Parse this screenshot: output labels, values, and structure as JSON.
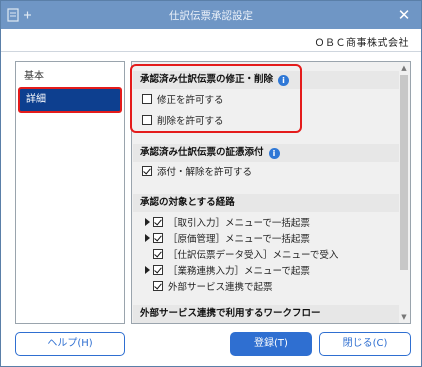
{
  "window": {
    "title": "仕訳伝票承認設定",
    "close_glyph": "✕",
    "company": "ＯＢＣ商事株式会社"
  },
  "nav": {
    "items": [
      {
        "label": "基本"
      },
      {
        "label": "詳細",
        "selected": true
      }
    ]
  },
  "content": {
    "section1": {
      "title": "承認済み仕訳伝票の修正・削除",
      "options": [
        {
          "label": "修正を許可する",
          "checked": false
        },
        {
          "label": "削除を許可する",
          "checked": false
        }
      ]
    },
    "section2": {
      "title": "承認済み仕訳伝票の証憑添付",
      "options": [
        {
          "label": "添付・解除を許可する",
          "checked": true
        }
      ]
    },
    "section3": {
      "title": "承認の対象とする経路",
      "routes": [
        {
          "label": "［取引入力］メニューで一括起票",
          "checked": true,
          "expandable": true
        },
        {
          "label": "［原価管理］メニューで一括起票",
          "checked": true,
          "expandable": true
        },
        {
          "label": "［仕訳伝票データ受入］メニューで受入",
          "checked": true,
          "expandable": false
        },
        {
          "label": "［業務連携入力］メニューで起票",
          "checked": true,
          "expandable": true
        },
        {
          "label": "外部サービス連携で起票",
          "checked": true,
          "expandable": false
        }
      ]
    },
    "section4": {
      "title": "外部サービス連携で利用するワークフロー"
    }
  },
  "buttons": {
    "help": "ヘルプ(H)",
    "register": "登録(T)",
    "close": "閉じる(C)"
  },
  "colors": {
    "titlebar": "#6f96c5",
    "selected_nav": "#0d3f8f",
    "highlight": "#e41b1b",
    "accent": "#2f6fd1"
  }
}
